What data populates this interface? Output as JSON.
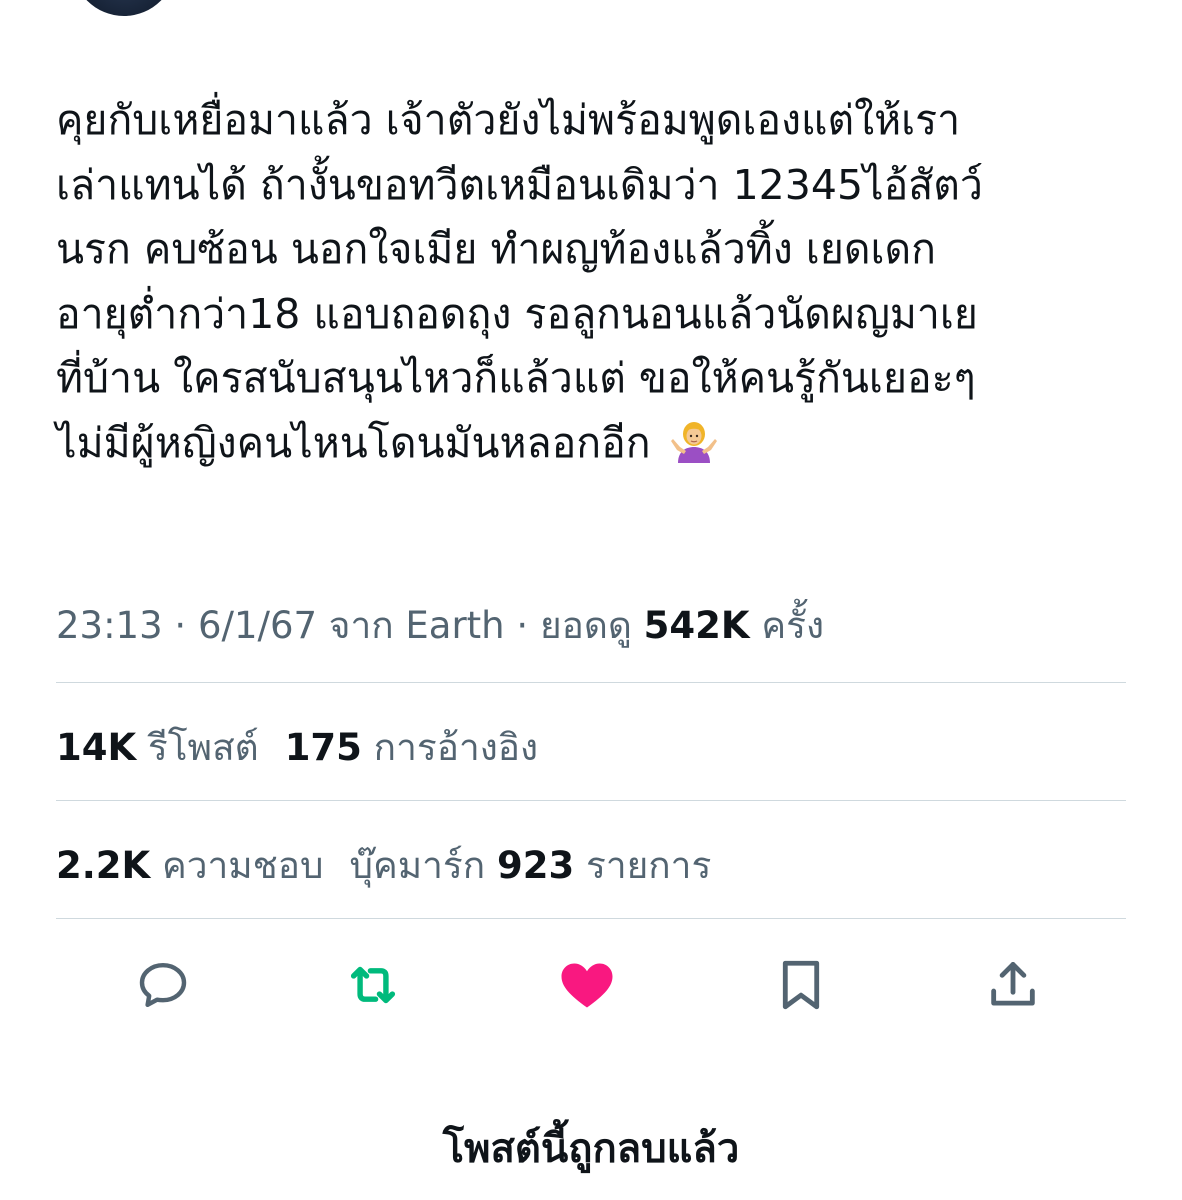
{
  "tweet": {
    "lines": [
      "คุยกับเหยื่อมาแล้ว เจ้าตัวยังไม่พร้อมพูดเองแต่ให้เรา",
      "เล่าแทนได้ ถ้างั้นขอทวีตเหมือนเดิมว่า 12345ไอ้สัตว์",
      "นรก คบซ้อน นอกใจเมีย ทำผญท้องแล้วทิ้ง เยดเดก",
      "อายุต่ำกว่า18 แอบถอดถุง รอลูกนอนแล้วนัดผญมาเย",
      "ที่บ้าน ใครสนับสนุนไหวก็แล้วแต่ ขอให้คนรู้กันเยอะๆ",
      "ไม่มีผู้หญิงคนไหนโดนมันหลอกอีก"
    ],
    "emoji": "woman-shrugging-emoji"
  },
  "meta": {
    "time": "23:13",
    "sep1": " · ",
    "date": "6/1/67",
    "source": " จาก Earth",
    "sep2": " · ",
    "views_label": "ยอดดู ",
    "views_count": "542K",
    "views_suffix": " ครั้ง"
  },
  "stats": {
    "reposts_count": "14K",
    "reposts_label": " รีโพสต์",
    "quotes_count": "175",
    "quotes_label": " การอ้างอิง",
    "likes_count": "2.2K",
    "likes_label": " ความชอบ",
    "bookmarks_label": "บุ๊คมาร์ก ",
    "bookmarks_count": "923",
    "bookmarks_suffix": " รายการ"
  },
  "actions": [
    {
      "name": "reply-icon",
      "color": "#536471"
    },
    {
      "name": "retweet-icon",
      "color": "#00ba7c"
    },
    {
      "name": "like-icon",
      "color": "#f91880"
    },
    {
      "name": "bookmark-icon",
      "color": "#536471"
    },
    {
      "name": "share-icon",
      "color": "#536471"
    }
  ],
  "footer": {
    "deleted_notice": "โพสต์นี้ถูกลบแล้ว"
  }
}
